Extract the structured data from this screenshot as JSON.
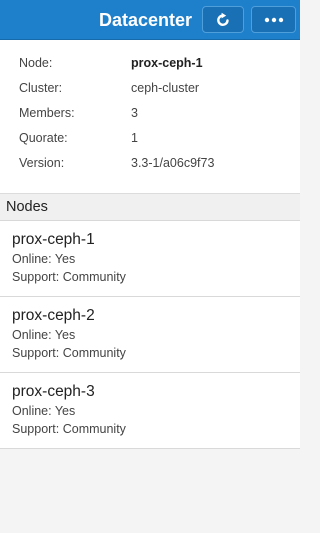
{
  "header": {
    "title": "Datacenter",
    "refresh_icon": "refresh-icon",
    "more_icon": "more-icon"
  },
  "summary": [
    {
      "key": "Node:",
      "value": "prox-ceph-1"
    },
    {
      "key": "Cluster:",
      "value": "ceph-cluster"
    },
    {
      "key": "Members:",
      "value": "3"
    },
    {
      "key": "Quorate:",
      "value": "1"
    },
    {
      "key": "Version:",
      "value": "3.3-1/a06c9f73"
    }
  ],
  "nodes_section": {
    "title": "Nodes",
    "items": [
      {
        "name": "prox-ceph-1",
        "online": "Online: Yes",
        "support": "Support: Community"
      },
      {
        "name": "prox-ceph-2",
        "online": "Online: Yes",
        "support": "Support: Community"
      },
      {
        "name": "prox-ceph-3",
        "online": "Online: Yes",
        "support": "Support: Community"
      }
    ]
  },
  "colors": {
    "titlebar": "#1e7fcb",
    "background": "#f4f4f4"
  }
}
